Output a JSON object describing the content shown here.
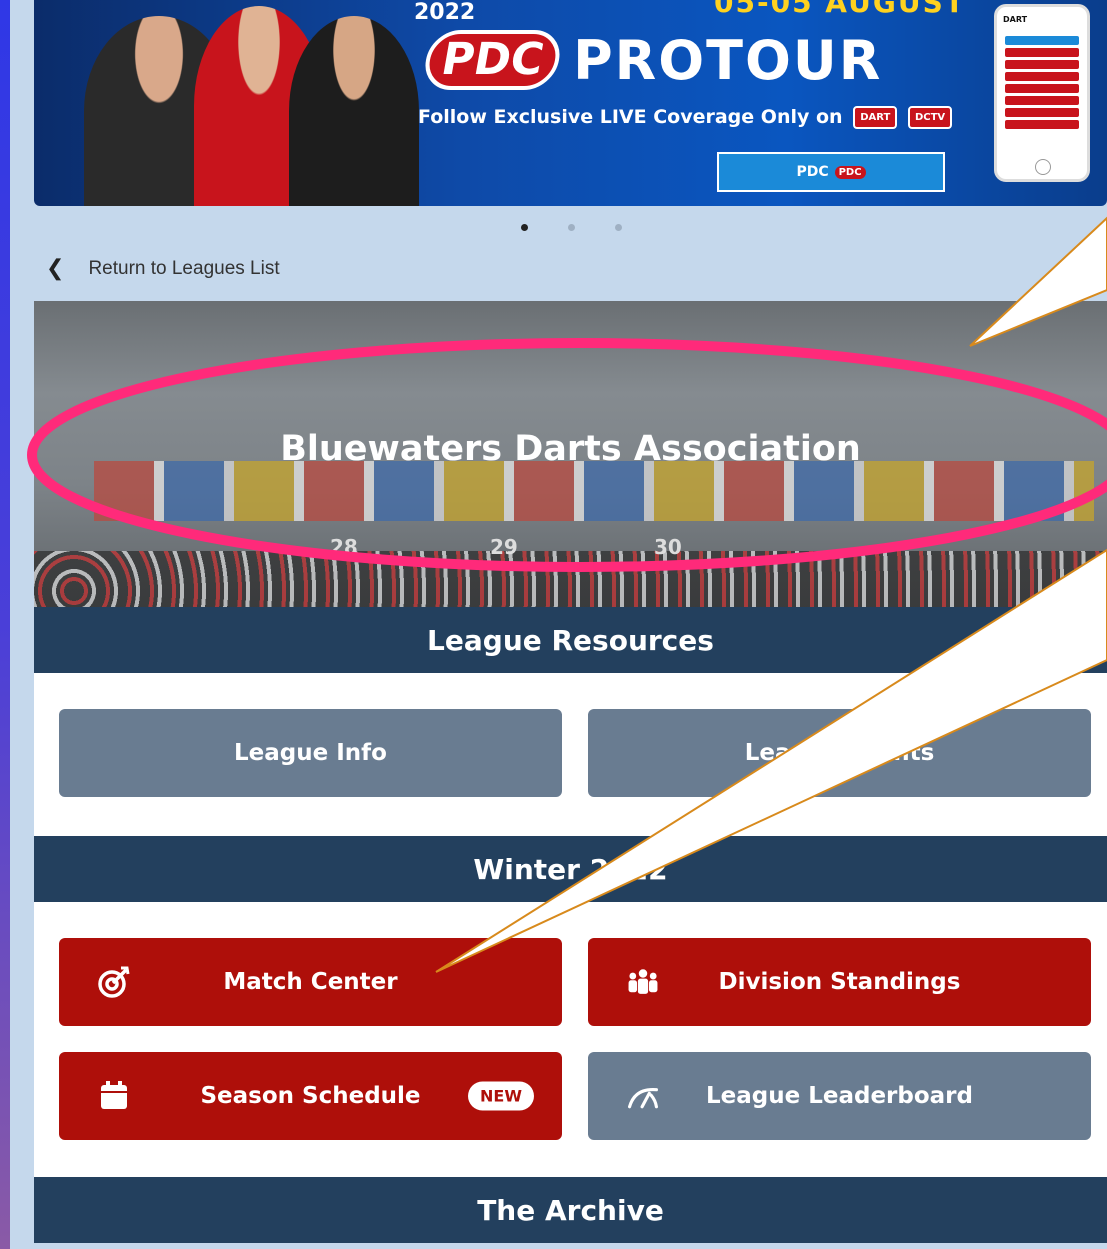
{
  "banner": {
    "year": "2022",
    "dates": "05-05 AUGUST",
    "brand": "PDC",
    "tour": "PROTOUR",
    "follow_text": "Follow Exclusive LIVE Coverage Only on",
    "badge_dart": "DART",
    "badge_dctv": "DCTV",
    "button_label": "PDC",
    "button_tag": "PDC",
    "phone_header": "DART"
  },
  "carousel": {
    "slides": 3,
    "active": 1
  },
  "nav": {
    "return_label": "Return to Leagues List"
  },
  "hero": {
    "title": "Bluewaters Darts Association",
    "board_numbers": [
      "28",
      "29",
      "30"
    ]
  },
  "sections": {
    "resources": {
      "title": "League Resources",
      "buttons": [
        {
          "label": "League Info"
        },
        {
          "label": "League Events"
        }
      ]
    },
    "season": {
      "title": "Winter 2022",
      "buttons": [
        {
          "label": "Match Center",
          "icon": "target-icon"
        },
        {
          "label": "Division Standings",
          "icon": "team-icon"
        },
        {
          "label": "Season Schedule",
          "icon": "calendar-icon",
          "badge": "NEW"
        },
        {
          "label": "League Leaderboard",
          "icon": "speedometer-icon"
        }
      ]
    },
    "archive": {
      "title": "The Archive"
    }
  },
  "colors": {
    "navy_header": "#23405e",
    "red_button": "#ae0f0a",
    "gray_button": "#697c91",
    "annotation_ring": "#ff2a7a",
    "annotation_outline": "#d88a1c"
  }
}
